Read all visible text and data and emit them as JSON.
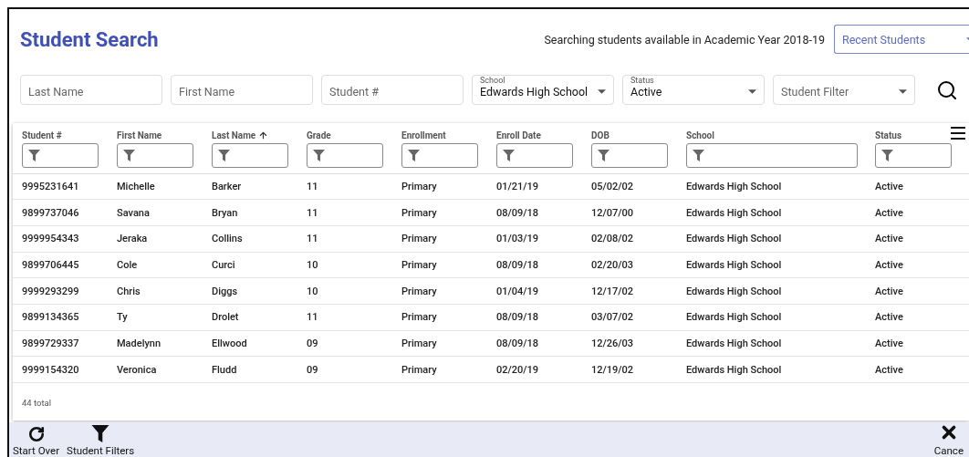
{
  "title": "Student Search",
  "year_note": "Searching students available in Academic Year 2018-19",
  "recent": {
    "value": "Recent Students"
  },
  "fields": [
    {
      "kind": "text",
      "placeholder": "Last Name"
    },
    {
      "kind": "text",
      "placeholder": "First Name"
    },
    {
      "kind": "text",
      "placeholder": "Student #"
    },
    {
      "kind": "select",
      "label": "School",
      "value": "Edwards High School"
    },
    {
      "kind": "select",
      "label": "Status",
      "value": "Active"
    },
    {
      "kind": "select",
      "placeholder": "Student Filter"
    }
  ],
  "table": {
    "columns": [
      {
        "label": "Student #",
        "sorted": false,
        "wide": false
      },
      {
        "label": "First Name",
        "sorted": false,
        "wide": false
      },
      {
        "label": "Last Name",
        "sorted": true,
        "wide": false
      },
      {
        "label": "Grade",
        "sorted": false,
        "wide": false
      },
      {
        "label": "Enrollment",
        "sorted": false,
        "wide": false
      },
      {
        "label": "Enroll Date",
        "sorted": false,
        "wide": false
      },
      {
        "label": "DOB",
        "sorted": false,
        "wide": false
      },
      {
        "label": "School",
        "sorted": false,
        "wide": true
      },
      {
        "label": "Status",
        "sorted": false,
        "wide": false
      }
    ],
    "rows": [
      [
        "9995231641",
        "Michelle",
        "Barker",
        "11",
        "Primary",
        "01/21/19",
        "05/02/02",
        "Edwards High School",
        "Active"
      ],
      [
        "9899737046",
        "Savana",
        "Bryan",
        "11",
        "Primary",
        "08/09/18",
        "12/07/00",
        "Edwards High School",
        "Active"
      ],
      [
        "9999954343",
        "Jeraka",
        "Collins",
        "11",
        "Primary",
        "01/03/19",
        "02/08/02",
        "Edwards High School",
        "Active"
      ],
      [
        "9899706445",
        "Cole",
        "Curci",
        "10",
        "Primary",
        "08/09/18",
        "02/20/03",
        "Edwards High School",
        "Active"
      ],
      [
        "9999293299",
        "Chris",
        "Diggs",
        "10",
        "Primary",
        "01/04/19",
        "12/17/02",
        "Edwards High School",
        "Active"
      ],
      [
        "9899134365",
        "Ty",
        "Drolet",
        "11",
        "Primary",
        "08/09/18",
        "03/07/02",
        "Edwards High School",
        "Active"
      ],
      [
        "9899729337",
        "Madelynn",
        "Ellwood",
        "09",
        "Primary",
        "08/09/18",
        "12/26/03",
        "Edwards High School",
        "Active"
      ],
      [
        "9999154320",
        "Veronica",
        "Fludd",
        "09",
        "Primary",
        "02/20/19",
        "12/19/02",
        "Edwards High School",
        "Active"
      ]
    ],
    "total": "44 total"
  },
  "actions": [
    {
      "kind": "refresh",
      "label": "Start Over"
    },
    {
      "kind": "filter",
      "label": "Student Filters"
    }
  ],
  "cancel": {
    "label": "Cance"
  }
}
